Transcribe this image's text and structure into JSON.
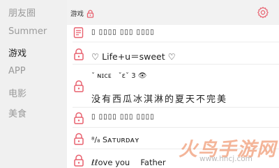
{
  "sidebar": {
    "items": [
      {
        "label": "朋友圈",
        "active": false
      },
      {
        "label": "Summer",
        "active": false
      },
      {
        "label": "游戏",
        "active": true
      },
      {
        "label": "APP",
        "active": false
      },
      {
        "label": "电影",
        "active": false
      },
      {
        "label": "美食",
        "active": false
      }
    ]
  },
  "header": {
    "title": "游戏",
    "lock_icon": "lock-icon",
    "settings_icon": "gear-icon"
  },
  "rows": [
    {
      "icon": "document-edit-icon",
      "text": "▯ ▯▯▯▯ ▯▯▯ ▯▯▯▯"
    },
    {
      "icon": "lock-icon",
      "text": "♡ Life+u＝sweet ♡"
    },
    {
      "icon": "",
      "text": "ˇ ɴɪᴄᴇ　ˇεˇ 3 👁"
    },
    {
      "icon": "lock-icon",
      "text": "没有西瓜冰淇淋的夏天不完美"
    },
    {
      "icon": "lock-icon",
      "text": "▯ ▯▯▯▯ ▯▯▯ ▯▯▯▯"
    },
    {
      "icon": "lock-icon",
      "text": "⁸/₈ Sᴀᴛᴜʀᴅᴀʏ"
    },
    {
      "icon": "lock-icon",
      "text": "ℓℓove you　 Father"
    }
  ],
  "watermark": {
    "brand": "火鸟手游网",
    "url": "www.hncj.com"
  },
  "colors": {
    "accent": "#e8606e",
    "sidebar_bg": "#f0f0f0",
    "header_bg": "#f2f2f2",
    "content_bg": "#ffffff"
  }
}
